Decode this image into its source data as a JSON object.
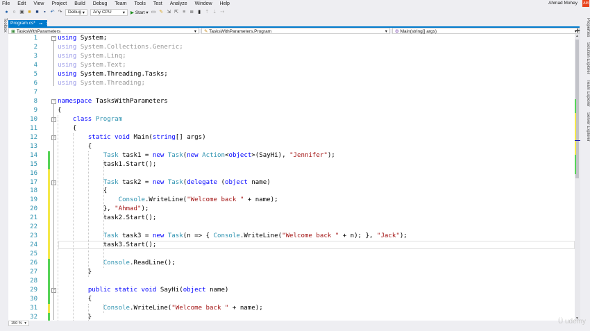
{
  "menu": [
    "File",
    "Edit",
    "View",
    "Project",
    "Build",
    "Debug",
    "Team",
    "Tools",
    "Test",
    "Analyze",
    "Window",
    "Help"
  ],
  "user": {
    "name": "Ahmad Mohey",
    "initials": "AM",
    "avatar_color": "#e8431c"
  },
  "toolbar": {
    "config": "Debug",
    "platform": "Any CPU",
    "start": "Start"
  },
  "toolbox_label": "Toolbox",
  "tab": {
    "label": "Program.cs*",
    "accent": "#007acc"
  },
  "navbar": {
    "project": "TasksWithParameters",
    "class": "TasksWithParameters.Program",
    "member": "Main(string[] args)"
  },
  "right_panels": [
    "Properties",
    "Solution Explorer",
    "Team Explorer",
    "Server Explorer"
  ],
  "zoom": "150 %",
  "watermark": "udemy",
  "code_lines": [
    [
      [
        "using",
        "dimkw0"
      ],
      [
        " System;",
        ""
      ]
    ],
    [
      [
        "using",
        "dimkw"
      ],
      [
        " System.Collections.Generic;",
        "dim"
      ]
    ],
    [
      [
        "using",
        "dimkw"
      ],
      [
        " System.Linq;",
        "dim"
      ]
    ],
    [
      [
        "using",
        "dimkw"
      ],
      [
        " System.Text;",
        "dim"
      ]
    ],
    [
      [
        "using",
        "kw"
      ],
      [
        " System.Threading.Tasks;",
        ""
      ]
    ],
    [
      [
        "using",
        "dimkw"
      ],
      [
        " System.Threading;",
        "dim"
      ]
    ],
    [],
    [
      [
        "namespace",
        "kw"
      ],
      [
        " TasksWithParameters",
        ""
      ]
    ],
    [
      [
        "{",
        ""
      ]
    ],
    [
      [
        "    ",
        ""
      ],
      [
        "class",
        "kw"
      ],
      [
        " ",
        ""
      ],
      [
        "Program",
        "ty"
      ]
    ],
    [
      [
        "    {",
        ""
      ]
    ],
    [
      [
        "        ",
        ""
      ],
      [
        "static void",
        "kw"
      ],
      [
        " Main(",
        ""
      ],
      [
        "string",
        "kw"
      ],
      [
        "[] args)",
        ""
      ]
    ],
    [
      [
        "        {",
        ""
      ]
    ],
    [
      [
        "            ",
        ""
      ],
      [
        "Task",
        "ty"
      ],
      [
        " task1 = ",
        ""
      ],
      [
        "new",
        "kw"
      ],
      [
        " ",
        ""
      ],
      [
        "Task",
        "ty"
      ],
      [
        "(",
        ""
      ],
      [
        "new",
        "kw"
      ],
      [
        " ",
        ""
      ],
      [
        "Action",
        "ty"
      ],
      [
        "<",
        ""
      ],
      [
        "object",
        "kw"
      ],
      [
        ">(SayHi), ",
        ""
      ],
      [
        "\"Jennifer\"",
        "st"
      ],
      [
        ");",
        ""
      ]
    ],
    [
      [
        "            task1.Start();",
        ""
      ]
    ],
    [],
    [
      [
        "            ",
        ""
      ],
      [
        "Task",
        "ty"
      ],
      [
        " task2 = ",
        ""
      ],
      [
        "new",
        "kw"
      ],
      [
        " ",
        ""
      ],
      [
        "Task",
        "ty"
      ],
      [
        "(",
        ""
      ],
      [
        "delegate",
        "kw"
      ],
      [
        " (",
        ""
      ],
      [
        "object",
        "kw"
      ],
      [
        " name)",
        ""
      ]
    ],
    [
      [
        "            {",
        ""
      ]
    ],
    [
      [
        "                ",
        ""
      ],
      [
        "Console",
        "ty"
      ],
      [
        ".WriteLine(",
        ""
      ],
      [
        "\"Welcome back \"",
        "st"
      ],
      [
        " + name);",
        ""
      ]
    ],
    [
      [
        "            }, ",
        ""
      ],
      [
        "\"Ahmad\"",
        "st"
      ],
      [
        ");",
        ""
      ]
    ],
    [
      [
        "            task2.Start();",
        ""
      ]
    ],
    [],
    [
      [
        "            ",
        ""
      ],
      [
        "Task",
        "ty"
      ],
      [
        " task3 = ",
        ""
      ],
      [
        "new",
        "kw"
      ],
      [
        " ",
        ""
      ],
      [
        "Task",
        "ty"
      ],
      [
        "(n => { ",
        ""
      ],
      [
        "Console",
        "ty"
      ],
      [
        ".WriteLine(",
        ""
      ],
      [
        "\"Welcome back \"",
        "st"
      ],
      [
        " + n); }, ",
        ""
      ],
      [
        "\"Jack\"",
        "st"
      ],
      [
        ");",
        ""
      ]
    ],
    [
      [
        "            task3.Start();",
        ""
      ]
    ],
    [],
    [
      [
        "            ",
        ""
      ],
      [
        "Console",
        "ty"
      ],
      [
        ".ReadLine();",
        ""
      ]
    ],
    [
      [
        "        }",
        ""
      ]
    ],
    [],
    [
      [
        "        ",
        ""
      ],
      [
        "public static void",
        "kw"
      ],
      [
        " SayHi(",
        ""
      ],
      [
        "object",
        "kw"
      ],
      [
        " name)",
        ""
      ]
    ],
    [
      [
        "        {",
        ""
      ]
    ],
    [
      [
        "            ",
        ""
      ],
      [
        "Console",
        "ty"
      ],
      [
        ".WriteLine(",
        ""
      ],
      [
        "\"Welcome back \"",
        "st"
      ],
      [
        " + name);",
        ""
      ]
    ],
    [
      [
        "        }",
        ""
      ]
    ]
  ],
  "change_markers": {
    "green": "#57d357",
    "yellow": "#f5e84a",
    "ranges": [
      [
        "green",
        14,
        15
      ],
      [
        "yellow",
        16,
        25
      ],
      [
        "green",
        26,
        30
      ],
      [
        "yellow",
        31,
        31
      ],
      [
        "green",
        32,
        32
      ]
    ]
  }
}
